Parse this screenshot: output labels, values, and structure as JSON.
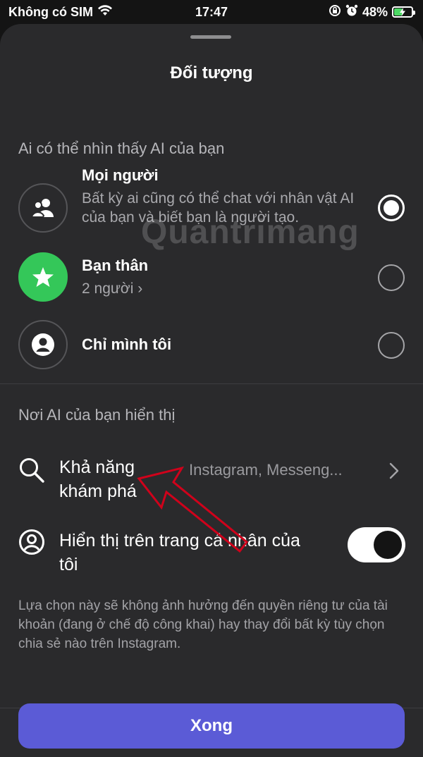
{
  "status_bar": {
    "carrier": "Không có SIM",
    "time": "17:47",
    "battery": "48%",
    "icons": [
      "wifi-icon",
      "rotation-lock-icon",
      "alarm-icon",
      "battery-charging-icon"
    ]
  },
  "sheet": {
    "title": "Đối tượng"
  },
  "audience": {
    "section_label": "Ai có thể nhìn thấy AI của bạn",
    "options": [
      {
        "title": "Mọi người",
        "description": "Bất kỳ ai cũng có thể chat với nhân vật AI của bạn và biết bạn là người tạo.",
        "icon": "people-icon",
        "selected": true
      },
      {
        "title": "Bạn thân",
        "description": "2 người ›",
        "icon": "star-icon",
        "selected": false
      },
      {
        "title": "Chỉ mình tôi",
        "description": "",
        "icon": "person-icon",
        "selected": false
      }
    ]
  },
  "placement": {
    "section_label": "Nơi AI của bạn hiển thị",
    "discovery": {
      "title": "Khả năng khám phá",
      "value": "Instagram, Messeng...",
      "icon": "search-icon"
    },
    "profile": {
      "title": "Hiển thị trên trang cá nhân của tôi",
      "icon": "profile-circle-icon",
      "toggle_on": true
    }
  },
  "footnote": "Lựa chọn này sẽ không ảnh hưởng đến quyền riêng tư của tài khoản (đang ở chế độ công khai) hay thay đổi bất kỳ tùy chọn chia sẻ nào trên Instagram.",
  "done_button": "Xong",
  "watermark": "Quantrimang",
  "colors": {
    "background": "#2a2a2c",
    "accent_button": "#5b5bd6",
    "close_friends": "#34c759",
    "annotation_arrow": "#d0021b"
  }
}
